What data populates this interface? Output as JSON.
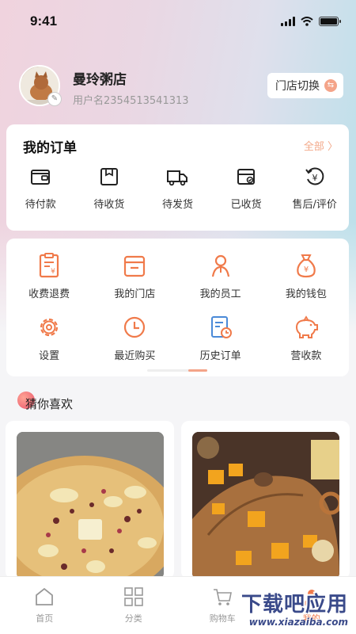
{
  "status_bar": {
    "time": "9:41"
  },
  "profile": {
    "store_name": "曼玲粥店",
    "username": "用户名2354513541313",
    "switch_label": "门店切换"
  },
  "orders": {
    "title": "我的订单",
    "all_label": "全部",
    "items": [
      {
        "label": "待付款",
        "icon": "wallet-icon"
      },
      {
        "label": "待收货",
        "icon": "box-icon"
      },
      {
        "label": "待发货",
        "icon": "truck-icon"
      },
      {
        "label": "已收货",
        "icon": "received-box-icon"
      },
      {
        "label": "售后/评价",
        "icon": "refund-icon"
      }
    ]
  },
  "services": {
    "row1": [
      {
        "label": "收费退费",
        "icon": "receipt-icon"
      },
      {
        "label": "我的门店",
        "icon": "store-icon"
      },
      {
        "label": "我的员工",
        "icon": "staff-icon"
      },
      {
        "label": "我的钱包",
        "icon": "money-bag-icon"
      }
    ],
    "row2": [
      {
        "label": "设置",
        "icon": "gear-icon"
      },
      {
        "label": "最近购买",
        "icon": "clock-icon"
      },
      {
        "label": "历史订单",
        "icon": "history-order-icon"
      },
      {
        "label": "营收款",
        "icon": "piggy-bank-icon"
      }
    ]
  },
  "recommend": {
    "title": "猜你喜欢"
  },
  "tabbar": {
    "items": [
      {
        "label": "首页",
        "icon": "home-icon"
      },
      {
        "label": "分类",
        "icon": "grid-icon"
      },
      {
        "label": "购物车",
        "icon": "cart-icon"
      },
      {
        "label": "我的",
        "icon": "user-icon"
      }
    ]
  },
  "watermark": {
    "title": "下载吧应用",
    "url": "www.xiazaiba.com"
  },
  "colors": {
    "accent": "#f07a4a",
    "accent_light": "#f4a489",
    "icon_dark": "#222222"
  }
}
